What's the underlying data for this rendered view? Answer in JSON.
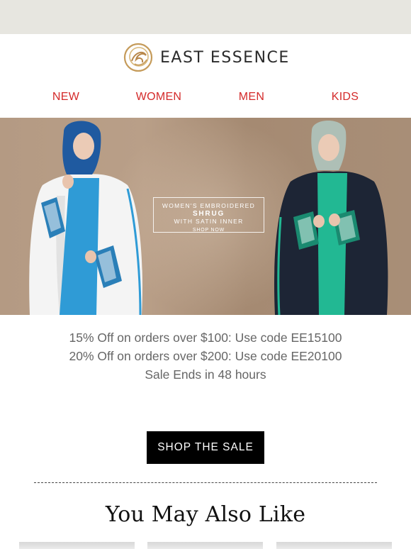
{
  "brand": {
    "name": "EAST ESSENCE",
    "gold": "#c59b5a"
  },
  "nav": {
    "items": [
      "NEW",
      "WOMEN",
      "MEN",
      "KIDS"
    ],
    "color": "#d42a2a"
  },
  "hero": {
    "line1": "WOMEN'S EMBROIDERED",
    "line2": "SHRUG",
    "line3": "WITH SATIN INNER",
    "shop": "SHOP NOW"
  },
  "offers": {
    "line1": "15% Off on orders over $100: Use code EE15100",
    "line2": "20% Off on orders over $200: Use code EE20100",
    "line3": "Sale Ends in 48 hours"
  },
  "cta": {
    "label": "SHOP THE SALE"
  },
  "recommendations": {
    "title": "You May Also Like"
  }
}
